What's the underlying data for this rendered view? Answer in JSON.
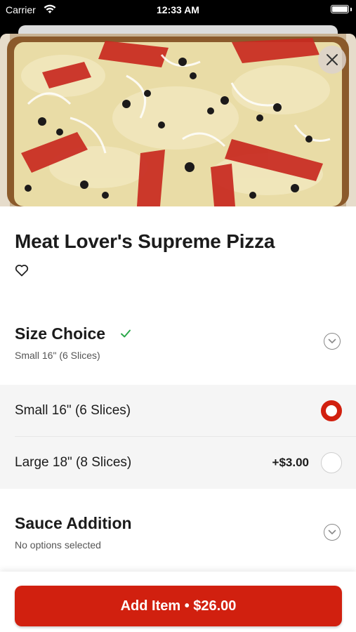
{
  "status_bar": {
    "carrier": "Carrier",
    "time": "12:33 AM"
  },
  "item": {
    "title": "Meat Lover's Supreme Pizza",
    "image": "pizza-photo"
  },
  "sections": [
    {
      "title": "Size Choice",
      "summary": "Small 16\" (6 Slices)",
      "complete": true
    },
    {
      "title": "Sauce Addition",
      "summary": "No options selected",
      "complete": false
    }
  ],
  "size_options": [
    {
      "label": "Small 16\" (6 Slices)",
      "price": "",
      "selected": true
    },
    {
      "label": "Large 18\" (8 Slices)",
      "price": "+$3.00",
      "selected": false
    }
  ],
  "cta": {
    "label": "Add Item • $26.00"
  },
  "colors": {
    "accent": "#d1200f",
    "check": "#2ba84a"
  },
  "icons": [
    "wifi-icon",
    "battery-icon",
    "close-icon",
    "heart-icon",
    "check-icon",
    "chevron-down-icon"
  ]
}
